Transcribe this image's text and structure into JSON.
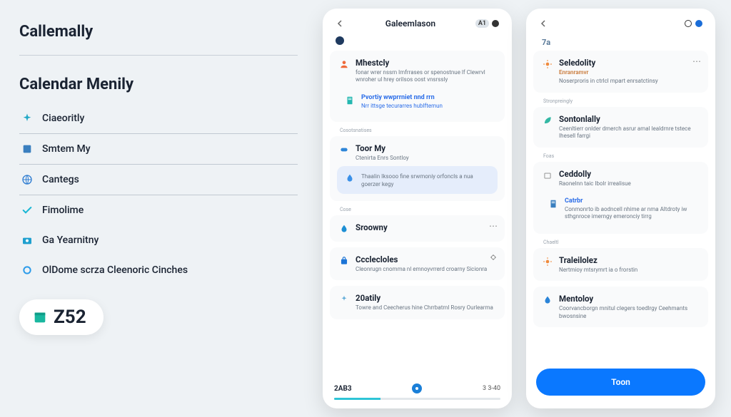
{
  "brand": "Callemally",
  "section_title": "Calendar Menily",
  "nav": [
    {
      "label": "Ciaeoritly",
      "icon": "spark",
      "color": "#22a9c6"
    },
    {
      "label": "Smtem My",
      "icon": "square",
      "color": "#3a7fbf"
    },
    {
      "label": "Cantegs",
      "icon": "globe",
      "color": "#2d7cd1"
    },
    {
      "label": "Fimolime",
      "icon": "check",
      "color": "#19b7d4"
    },
    {
      "label": "Ga Yearnitny",
      "icon": "camera",
      "color": "#1fa0cf"
    },
    {
      "label": "OlDome scrza Cleenoric Cinches",
      "icon": "ring",
      "color": "#2b9bea"
    }
  ],
  "badge_number": "Z52",
  "phone_a": {
    "badge": "A1",
    "title": "Galeemlason",
    "sections": [
      {
        "type": "card",
        "icon": "person",
        "iconColor": "#ef6a3a",
        "title": "Mhestcly",
        "desc": "fonar wrer nssrn lmfrrases or spenostnue lf Clewrvl wnroher ul hrey orilsos oost vnsrssly",
        "sub": {
          "icon": "doc",
          "iconColor": "#24b7b0",
          "title": "Pvortiy wwprrniet nnd rrn",
          "link": "Nrr ittsge tecurarres hublftemun"
        }
      },
      {
        "type": "micro",
        "text": "Cosotsnatises"
      },
      {
        "type": "card",
        "icon": "pill",
        "iconColor": "#2e86d8",
        "title": "Toor My",
        "desc": "Ctenirta Enrs\nSontloy",
        "sub": {
          "highlight": true,
          "icon": "drop",
          "iconColor": "#3a90e8",
          "desc": "Thaalin Iksooo fine srwmoniy orfoncls a nua goerzer kegy"
        }
      },
      {
        "type": "micro",
        "text": "Cose"
      },
      {
        "type": "card",
        "icon": "drop",
        "iconColor": "#1d8fd4",
        "title": "Sroowny",
        "desc": "",
        "more": true
      },
      {
        "type": "card",
        "icon": "bag",
        "iconColor": "#1c74d6",
        "title": "Ccclecloles",
        "desc": "Cleonrugn cnomma nl emnoyvrrerd croarny Sicionra",
        "side_icon": true
      },
      {
        "type": "card",
        "icon": "sparkle",
        "iconColor": "#5aa8d6",
        "title": "20atily",
        "desc": "Towre and Ceecherus hine Chrrbatrnl Rosry Ourlearma"
      }
    ],
    "tabs": {
      "left": "2AB3",
      "right": "3 3-40"
    }
  },
  "phone_b": {
    "title_badge": "7a",
    "sections": [
      {
        "type": "card",
        "icon": "burst",
        "iconColor": "#f08a3c",
        "title": "Seledolity",
        "subtitle": "Enranramvr",
        "desc": "Noserproris in ctrlcl mpart enrsatctinsy",
        "more": true
      },
      {
        "type": "micro",
        "text": "Stronpreingly"
      },
      {
        "type": "card",
        "icon": "leaf",
        "iconColor": "#34b8a4",
        "title": "Sontonlally",
        "desc": "Ceenltierr onlder dmerch asrur amal lealdrnre tstece Ihesell farrgi"
      },
      {
        "type": "micro",
        "text": "Foas"
      },
      {
        "type": "card",
        "icon": "box",
        "iconColor": "#888",
        "title": "Ceddolly",
        "desc": "Raonelnn taic Ibolr irrealisue",
        "sub": {
          "title": "Catrbr",
          "desc": "Conmonrto ib aodncell nhime ar nma Altdroty iw sthgnroce imerngy emeronciy tirrg"
        }
      },
      {
        "type": "micro",
        "text": "Chaeltl"
      },
      {
        "type": "card",
        "icon": "burst",
        "iconColor": "#f08a3c",
        "title": "Traleilolez",
        "desc": "Nertmioy mtsrymrt ia o frorstin"
      },
      {
        "type": "card",
        "icon": "drop",
        "iconColor": "#2a84d8",
        "title": "Mentoloy",
        "desc": "Coorvancborgn mnitul clegers toedlrgy Ceehmants bwosnsine"
      }
    ],
    "cta": "Toon"
  }
}
